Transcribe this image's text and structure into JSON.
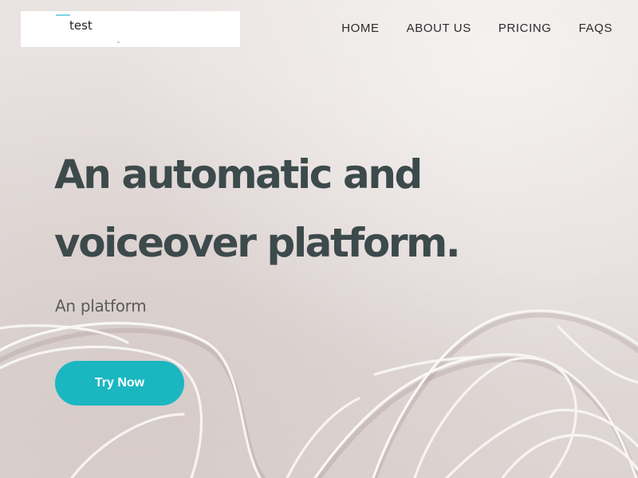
{
  "brand": {
    "name": "test"
  },
  "nav": {
    "items": [
      {
        "label": "HOME"
      },
      {
        "label": "ABOUT US"
      },
      {
        "label": "PRICING"
      },
      {
        "label": "FAQS"
      }
    ]
  },
  "hero": {
    "headline": "An automatic and voiceover platform.",
    "subheadline": "An platform",
    "cta_label": "Try Now"
  },
  "colors": {
    "accent": "#1ab7c1",
    "headline": "#3d4a4c",
    "background": "#e6dfdd"
  }
}
